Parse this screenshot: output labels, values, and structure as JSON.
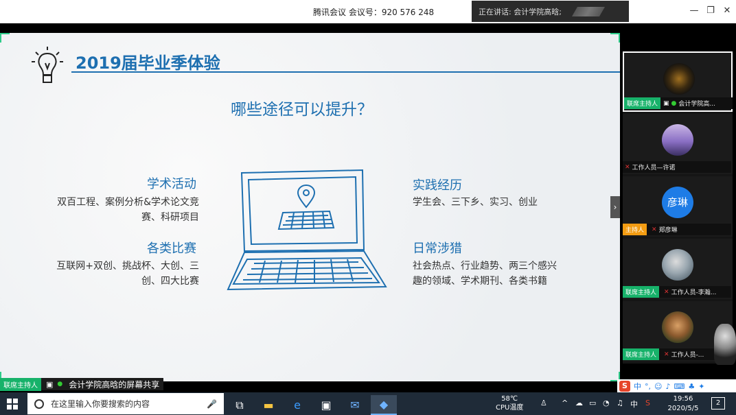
{
  "window": {
    "meeting_label": "腾讯会议 会议号：920 576 248",
    "speaking_label": "正在讲话: 会计学院高晗;",
    "minimize": "—",
    "restore": "❐",
    "close": "✕"
  },
  "slide": {
    "title": "2019届毕业季体验",
    "question": "哪些途径可以提升？",
    "sections": [
      {
        "title": "学术活动",
        "body1": "双百工程、案例分析&学术论文竞",
        "body2": "赛、科研项目"
      },
      {
        "title": "各类比赛",
        "body1": "互联网+双创、挑战杯、大创、三",
        "body2": "创、四大比赛"
      },
      {
        "title": "实践经历",
        "body1": "学生会、三下乡、实习、创业",
        "body2": ""
      },
      {
        "title": "日常涉猎",
        "body1": "社会热点、行业趋势、两三个感兴",
        "body2": "趣的领域、学术期刊、各类书籍"
      }
    ],
    "accent_color": "#1d6fb0"
  },
  "share": {
    "host_badge": "联席主持人",
    "label": "会计学院高晗的屏幕共享"
  },
  "participants": [
    {
      "badge": "联席主持人",
      "name": "会计学院高...",
      "avatar": "",
      "mic": "on"
    },
    {
      "badge": "",
      "name": "工作人员—许诺",
      "avatar": "",
      "mic": "muted"
    },
    {
      "badge": "主持人",
      "name": "郑彦琳",
      "avatar": "彦琳",
      "mic": "muted"
    },
    {
      "badge": "联席主持人",
      "name": "工作人员-李瀚...",
      "avatar": "",
      "mic": "muted"
    },
    {
      "badge": "联席主持人",
      "name": "工作人员-...",
      "avatar": "",
      "mic": "muted"
    }
  ],
  "ime": {
    "lang": "中"
  },
  "taskbar": {
    "search_placeholder": "在这里输入你要搜索的内容",
    "temp": "58℃",
    "temp_label": "CPU温度",
    "tray_lang": "中",
    "time": "19:56",
    "date": "2020/5/5",
    "notify_count": "2"
  }
}
